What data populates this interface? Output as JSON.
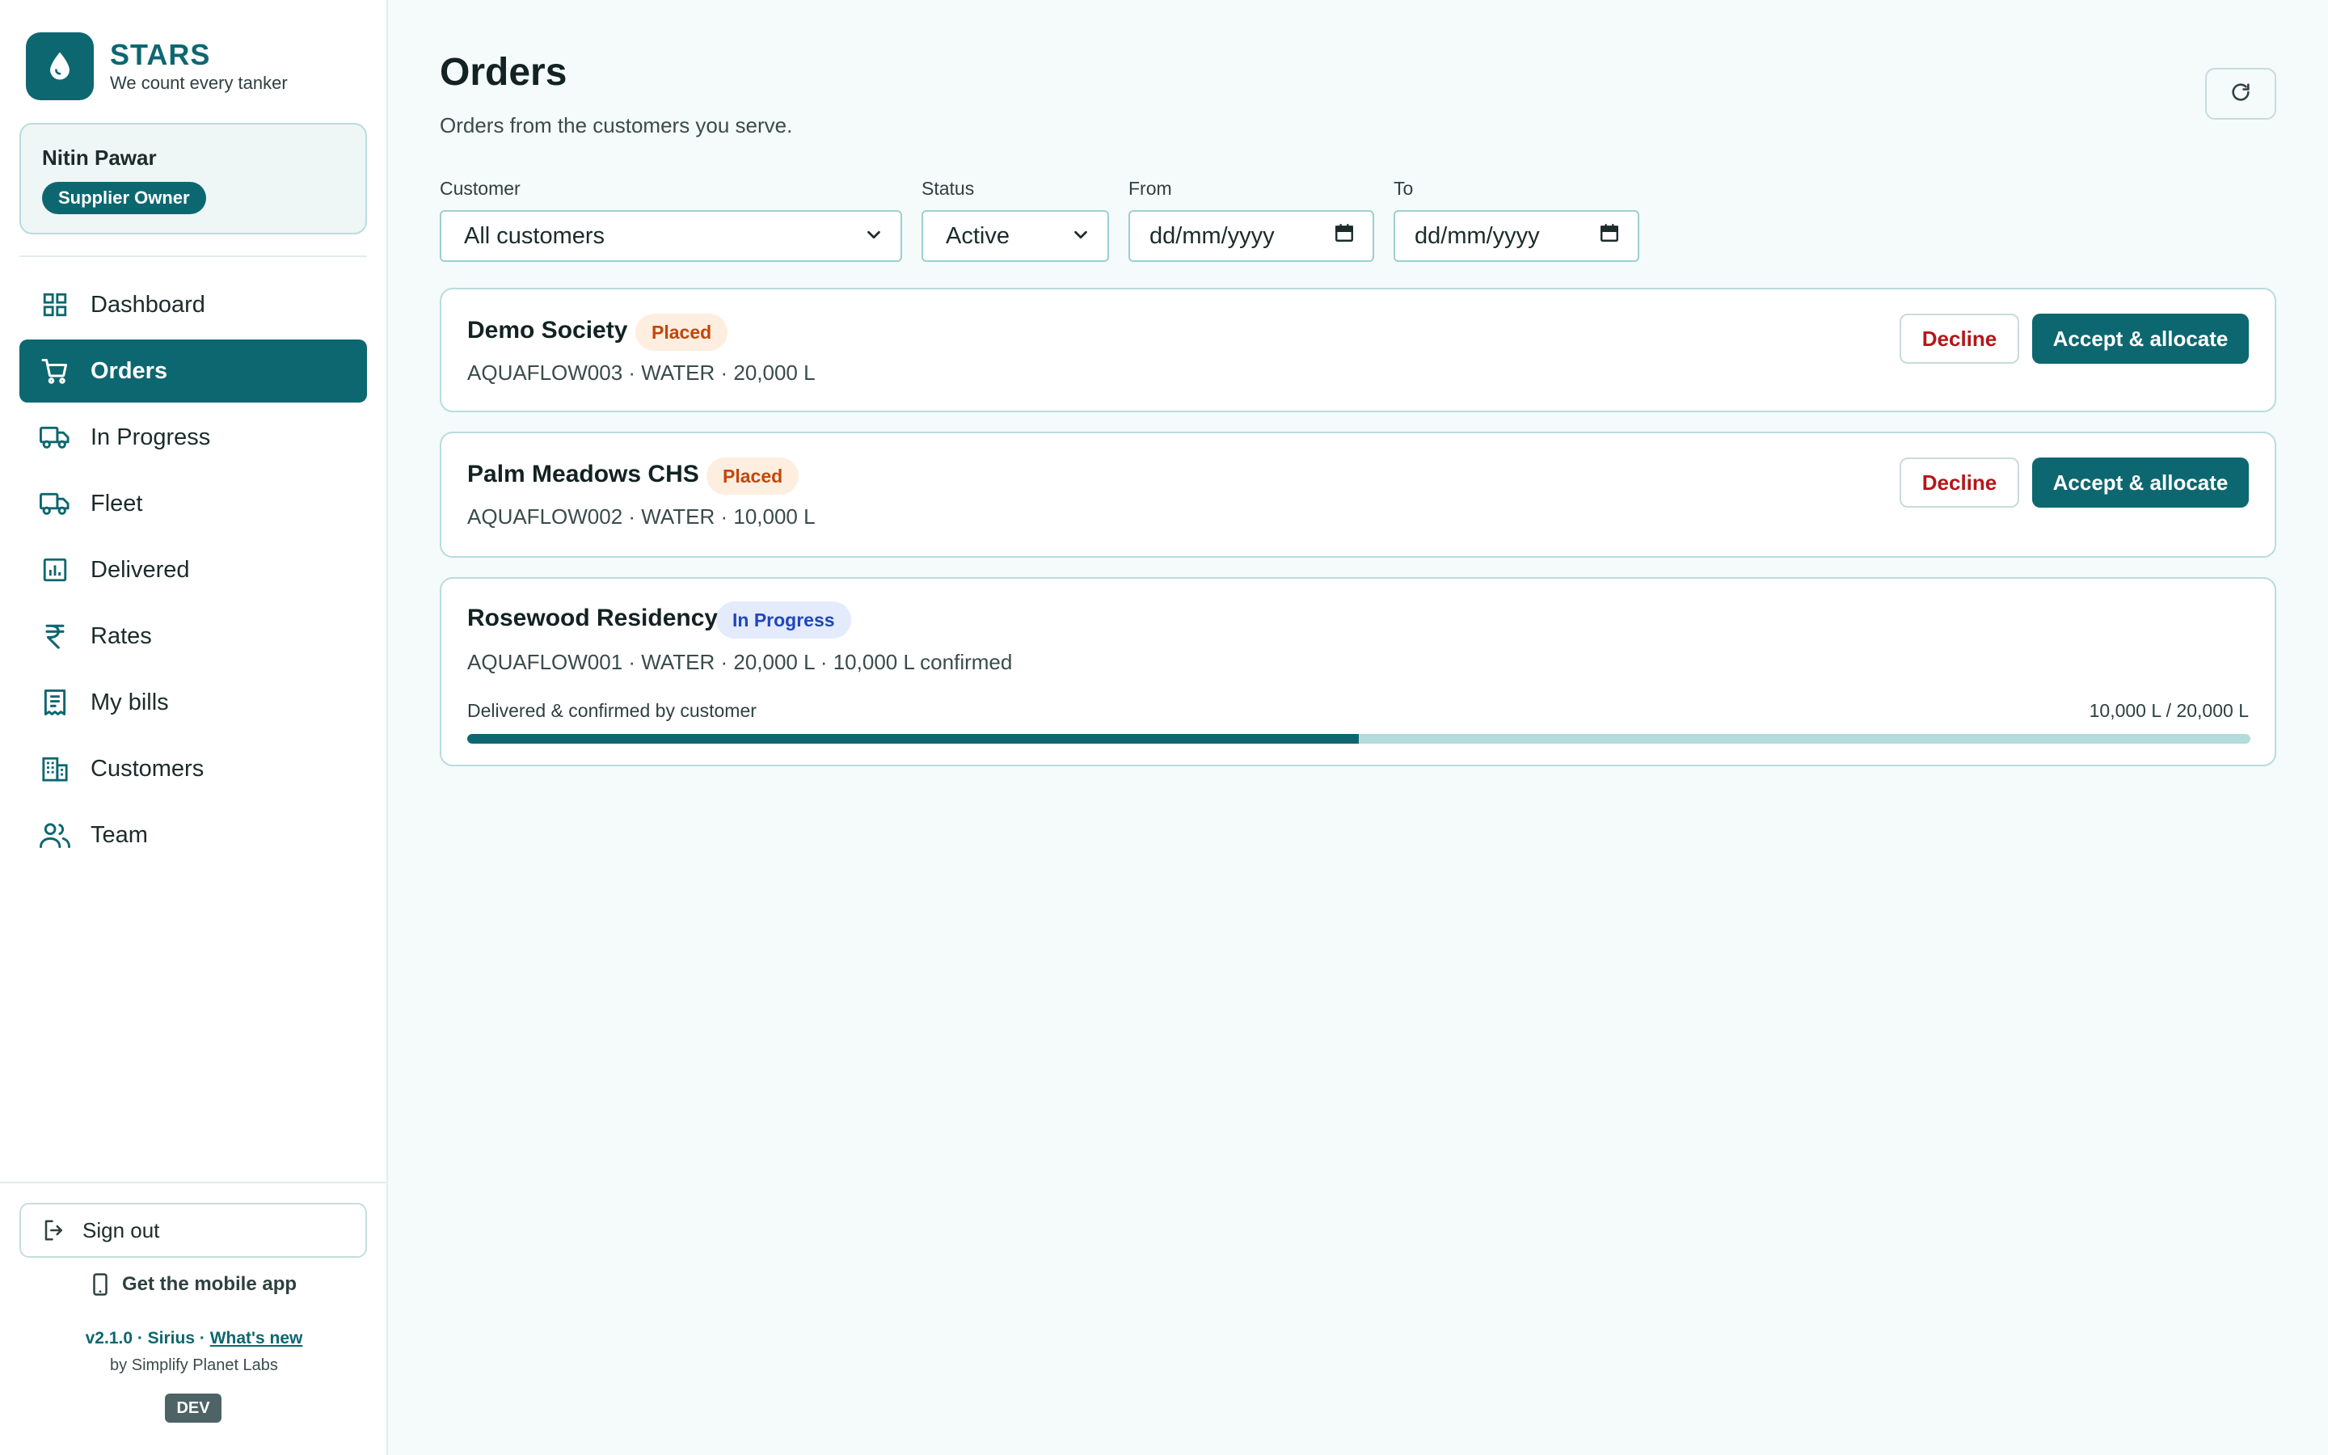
{
  "brand": {
    "name": "STARS",
    "tagline": "We count every tanker"
  },
  "user": {
    "name": "Nitin Pawar",
    "role": "Supplier Owner"
  },
  "nav": [
    {
      "id": "dashboard",
      "label": "Dashboard",
      "icon": "grid-icon"
    },
    {
      "id": "orders",
      "label": "Orders",
      "icon": "cart-icon",
      "active": true
    },
    {
      "id": "in-progress",
      "label": "In Progress",
      "icon": "truck-icon"
    },
    {
      "id": "fleet",
      "label": "Fleet",
      "icon": "truck-icon"
    },
    {
      "id": "delivered",
      "label": "Delivered",
      "icon": "bar-chart-icon"
    },
    {
      "id": "rates",
      "label": "Rates",
      "icon": "rupee-icon"
    },
    {
      "id": "my-bills",
      "label": "My bills",
      "icon": "receipt-icon"
    },
    {
      "id": "customers",
      "label": "Customers",
      "icon": "building-icon"
    },
    {
      "id": "team",
      "label": "Team",
      "icon": "users-icon"
    }
  ],
  "footer": {
    "signout": "Sign out",
    "mobile_app": "Get the mobile app",
    "version": "v2.1.0 · Sirius · ",
    "whats_new": "What's new",
    "byline": "by Simplify Planet Labs",
    "env": "DEV"
  },
  "page": {
    "title": "Orders",
    "subtitle": "Orders from the customers you serve."
  },
  "filters": {
    "customer": {
      "label": "Customer",
      "value": "All customers"
    },
    "status": {
      "label": "Status",
      "value": "Active"
    },
    "from": {
      "label": "From",
      "value": "dd/mm/yyyy"
    },
    "to": {
      "label": "To",
      "value": "dd/mm/yyyy"
    }
  },
  "orders": [
    {
      "customer": "Demo Society",
      "status": "Placed",
      "meta": "AQUAFLOW003 · WATER · 20,000 L",
      "decline": "Decline",
      "accept": "Accept & allocate"
    },
    {
      "customer": "Palm Meadows CHS",
      "status": "Placed",
      "meta": "AQUAFLOW002 · WATER · 10,000 L",
      "decline": "Decline",
      "accept": "Accept & allocate"
    },
    {
      "customer": "Rosewood Residency",
      "status": "In Progress",
      "meta": "AQUAFLOW001 · WATER · 20,000 L · 10,000 L confirmed",
      "progress_label": "Delivered & confirmed by customer",
      "progress_text": "10,000 L / 20,000 L",
      "progress_fraction": 0.5
    }
  ],
  "colors": {
    "primary": "#0d6770",
    "placed_bg": "#fdeee0",
    "placed_text": "#c2470a",
    "progress_bg": "#e3ebfc",
    "progress_text": "#2146b8",
    "decline_text": "#b3171a"
  }
}
